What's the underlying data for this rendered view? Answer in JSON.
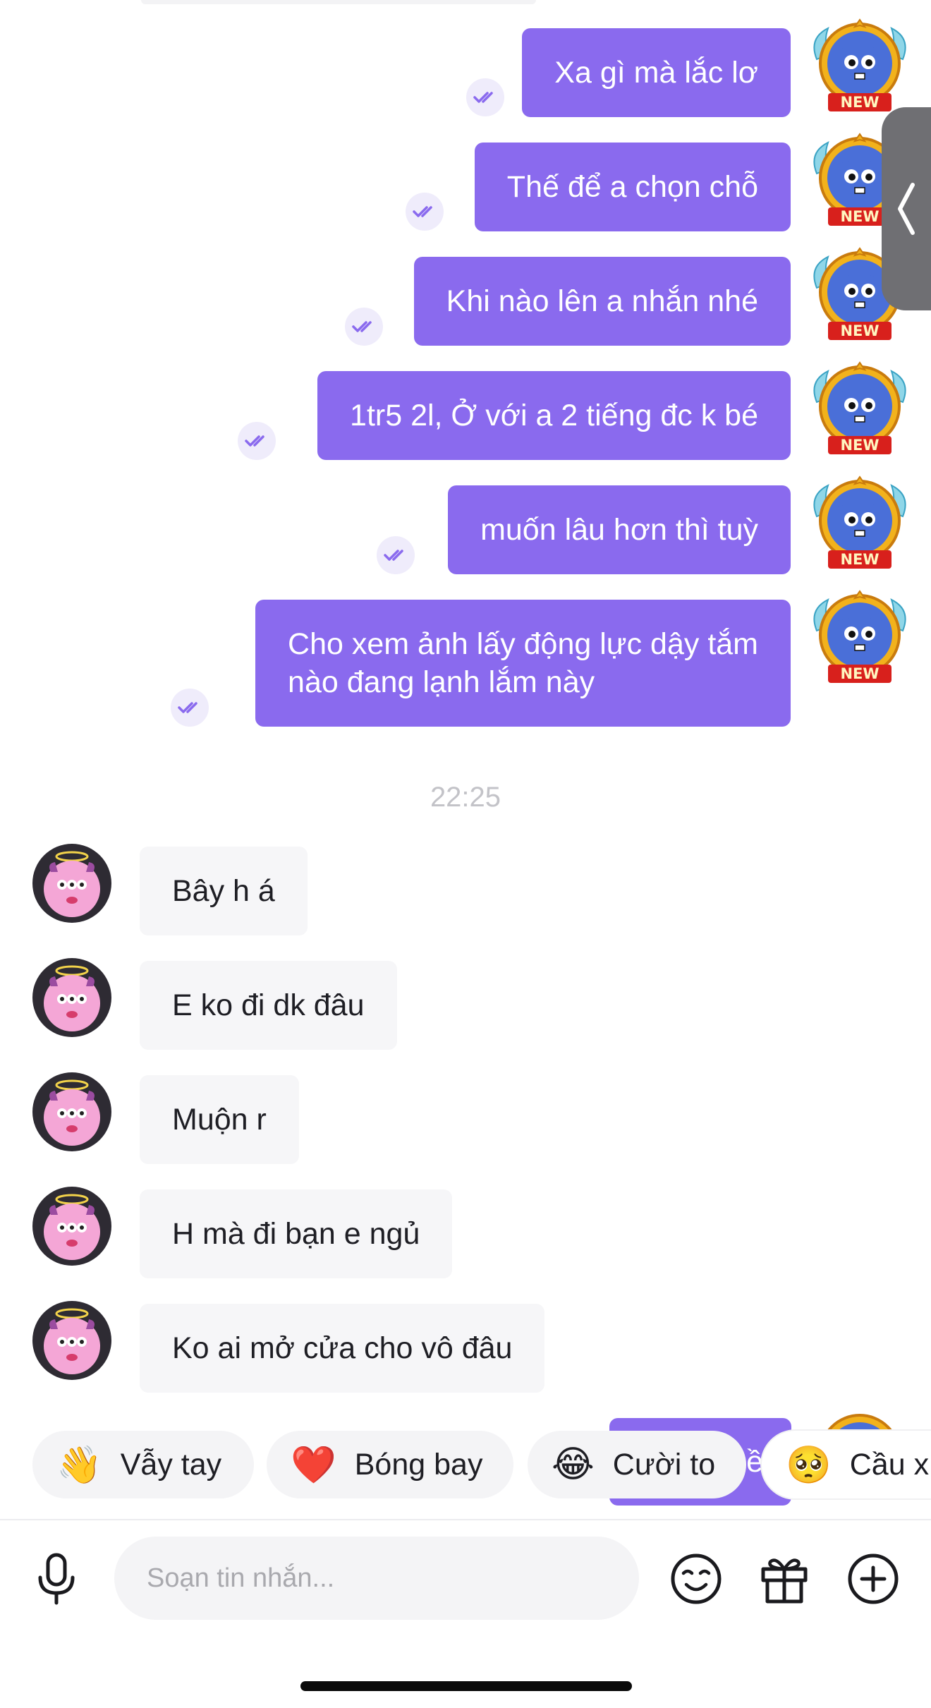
{
  "outgoing_messages": [
    {
      "text": "Xa gì mà lắc lơ",
      "badge": "NEW"
    },
    {
      "text": "Thế để a chọn chỗ",
      "badge": "NEW"
    },
    {
      "text": "Khi nào lên a nhắn nhé",
      "badge": "NEW"
    },
    {
      "text": "1tr5 2l, Ở với a 2 tiếng đc k bé",
      "badge": "NEW"
    },
    {
      "text": "muốn lâu hơn thì tuỳ",
      "badge": "NEW"
    },
    {
      "text": "Cho xem ảnh lấy động lực dậy tắm\nnào đang lạnh lắm này",
      "badge": "NEW"
    }
  ],
  "timestamp": "22:25",
  "incoming_messages": [
    {
      "text": "Bây h á"
    },
    {
      "text": "E ko đi dk đâu"
    },
    {
      "text": "Muộn r"
    },
    {
      "text": "H mà đi bạn e ngủ"
    },
    {
      "text": "Ko ai mở cửa cho vô đâu"
    }
  ],
  "quick_replies": [
    {
      "emoji": "👋",
      "label": "Vẫy tay"
    },
    {
      "emoji": "❤️",
      "label": "Bóng bay"
    },
    {
      "emoji": "😂",
      "label": "Cười to"
    },
    {
      "emoji": "🥺",
      "label": "Cầu x"
    }
  ],
  "partial_bubble_text": "ề",
  "composer": {
    "placeholder": "Soạn tin nhắn..."
  },
  "colors": {
    "accent": "#8a6aee",
    "incoming_bg": "#f6f6f8"
  }
}
